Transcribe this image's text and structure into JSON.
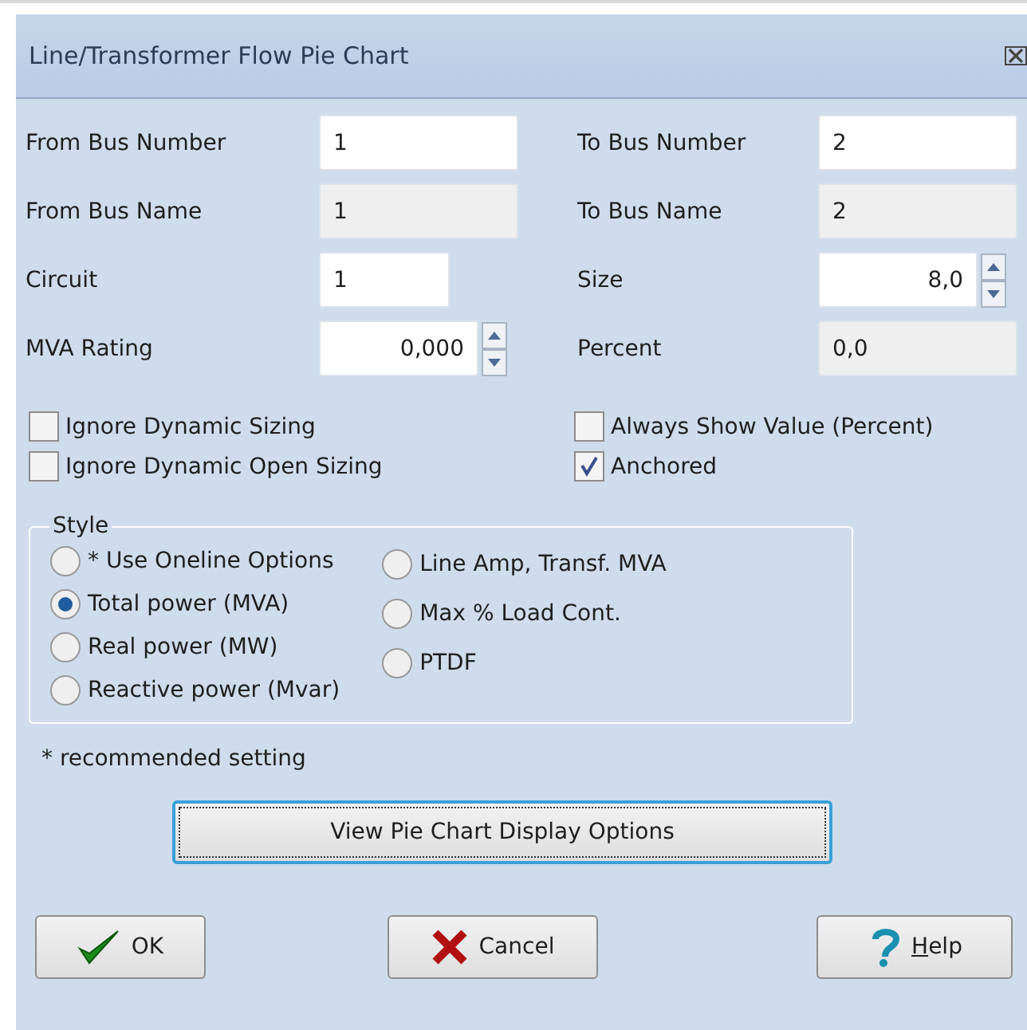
{
  "window": {
    "title": "Line/Transformer Flow Pie Chart"
  },
  "fields": [
    {
      "label": "From Bus Number",
      "value": "1",
      "kind": "text"
    },
    {
      "label": "To Bus Number",
      "value": "2",
      "kind": "text"
    },
    {
      "label": "From Bus Name",
      "value": "1",
      "kind": "readonly"
    },
    {
      "label": "To Bus Name",
      "value": "2",
      "kind": "readonly"
    },
    {
      "label": "Circuit",
      "value": "1",
      "kind": "short"
    },
    {
      "label": "Size",
      "value": "8,0",
      "kind": "spin"
    },
    {
      "label": "MVA Rating",
      "value": "0,000",
      "kind": "spin"
    },
    {
      "label": "Percent",
      "value": "0,0",
      "kind": "readonly"
    }
  ],
  "checkboxes": [
    {
      "label": "Ignore Dynamic Sizing",
      "checked": false
    },
    {
      "label": "Always Show Value (Percent)",
      "checked": false
    },
    {
      "label": "Ignore Dynamic Open Sizing",
      "checked": false
    },
    {
      "label": "Anchored",
      "checked": true
    }
  ],
  "style_group": {
    "title": "Style",
    "columns": [
      [
        {
          "label": "* Use Oneline Options",
          "selected": false
        },
        {
          "label": "Total power (MVA)",
          "selected": true
        },
        {
          "label": "Real power (MW)",
          "selected": false
        },
        {
          "label": "Reactive power (Mvar)",
          "selected": false
        }
      ],
      [
        {
          "label": "Line Amp, Transf. MVA",
          "selected": false
        },
        {
          "label": "Max % Load Cont.",
          "selected": false
        },
        {
          "label": "PTDF",
          "selected": false
        }
      ]
    ]
  },
  "note": "* recommended setting",
  "options_button": {
    "label": "View Pie Chart Display Options",
    "focused": true
  },
  "buttons": [
    {
      "label": "OK",
      "kind": "ok"
    },
    {
      "label": "Cancel",
      "kind": "cancel"
    },
    {
      "label": "Help",
      "kind": "help",
      "underline_first": true
    }
  ]
}
